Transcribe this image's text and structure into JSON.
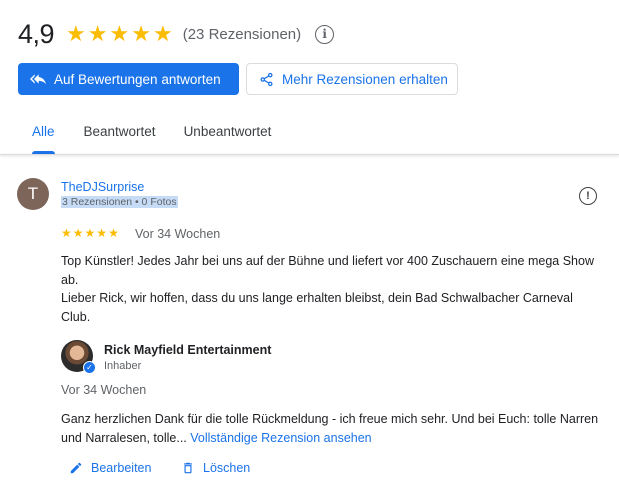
{
  "summary": {
    "rating": "4,9",
    "stars": 5,
    "review_count": "(23 Rezensionen)",
    "info_icon": "info-icon"
  },
  "actions": {
    "reply_button": "Auf Bewertungen antworten",
    "get_more_button": "Mehr Rezensionen erhalten"
  },
  "tabs": [
    {
      "label": "Alle",
      "active": true
    },
    {
      "label": "Beantwortet",
      "active": false
    },
    {
      "label": "Unbeantwortet",
      "active": false
    }
  ],
  "review": {
    "avatar_letter": "T",
    "reviewer_name": "TheDJSurprise",
    "reviewer_meta": "3 Rezensionen • 0 Fotos",
    "rating": 5,
    "time": "Vor 34 Wochen",
    "text_line1": "Top Künstler! Jedes Jahr bei uns auf der Bühne und liefert vor 400 Zuschauern eine mega Show ab.",
    "text_line2": "Lieber Rick, wir hoffen, dass du uns lange erhalten bleibst, dein Bad Schwalbacher Carneval Club."
  },
  "reply": {
    "owner_name": "Rick Mayfield Entertainment",
    "owner_role": "Inhaber",
    "time": "Vor 34 Wochen",
    "text": "Ganz herzlichen Dank für die tolle Rückmeldung - ich freue mich sehr. Und bei Euch: tolle Narren und Narralesen, tolle...",
    "more_link": "Vollständige Rezension ansehen",
    "edit_label": "Bearbeiten",
    "delete_label": "Löschen"
  },
  "colors": {
    "accent": "#1a73e8",
    "star": "#fbbc04",
    "avatar": "#7d655a"
  }
}
